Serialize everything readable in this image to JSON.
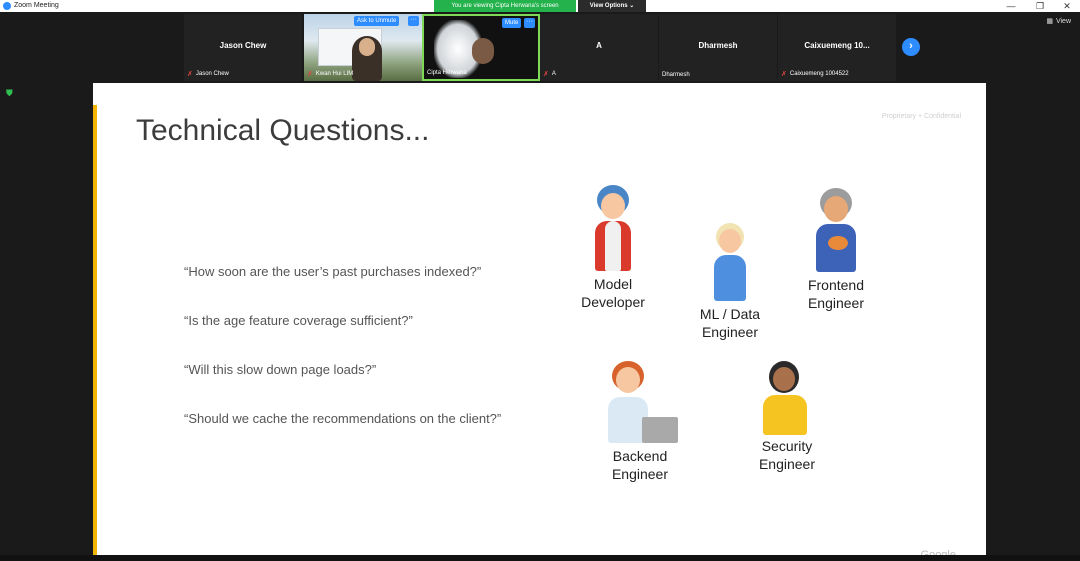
{
  "window": {
    "title": "Zoom Meeting",
    "controls": [
      "—",
      "❐",
      "✕"
    ]
  },
  "share_banner": "You are viewing Cipta Herwana's screen",
  "view_options": "View Options ⌄",
  "view_button": "View",
  "participants": [
    {
      "name_center": "Jason Chew",
      "name_small": "Jason Chew"
    },
    {
      "name_small": "Kwan Hui LIM",
      "action": "Ask to Unmute"
    },
    {
      "name_small": "Cipta Herwana",
      "action": "Mute"
    },
    {
      "name_center": "A",
      "name_small": "A"
    },
    {
      "name_center": "Dharmesh",
      "name_small": "Dharmesh"
    },
    {
      "name_center": "Caixuemeng  10...",
      "name_small": "Caixuemeng 1004522"
    }
  ],
  "slide": {
    "title": "Technical Questions...",
    "confidential": "Proprietary + Confidential",
    "questions": [
      "“How soon are the user’s past purchases indexed?”",
      "“Is the age feature coverage sufficient?”",
      "“Will this slow down page loads?”",
      "“Should we cache the recommendations on the client?”"
    ],
    "personas": {
      "model_developer": [
        "Model",
        "Developer"
      ],
      "ml_data_engineer": [
        "ML / Data",
        "Engineer"
      ],
      "frontend_engineer": [
        "Frontend",
        "Engineer"
      ],
      "backend_engineer": [
        "Backend",
        "Engineer"
      ],
      "security_engineer": [
        "Security",
        "Engineer"
      ]
    },
    "footer_logo": "Google"
  }
}
